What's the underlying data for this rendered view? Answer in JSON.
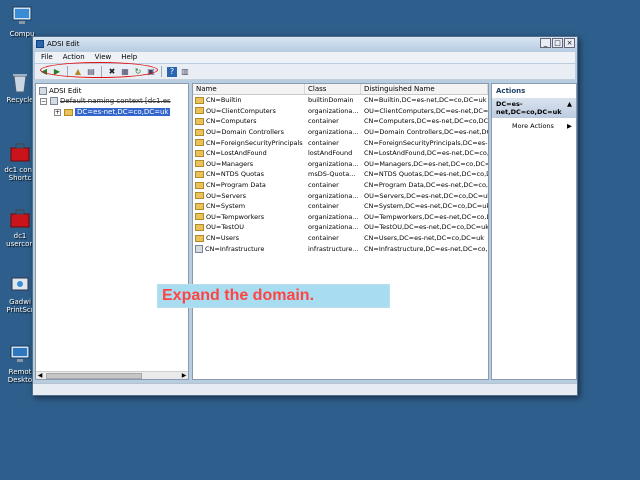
{
  "desktop": {
    "icons": [
      {
        "label": "Compu",
        "icon": "computer-icon"
      },
      {
        "label": "Recycle",
        "icon": "recycle-bin-icon"
      },
      {
        "label": "dc1 cons",
        "label2": "Shortc",
        "icon": "toolbox-icon"
      },
      {
        "label": "dc1",
        "label2": "usercon",
        "icon": "toolbox-icon"
      },
      {
        "label": "Gadwi",
        "label2": "PrintScr",
        "icon": "printscreen-icon"
      },
      {
        "label": "Remot",
        "label2": "Deskto",
        "icon": "remote-desktop-icon"
      }
    ]
  },
  "window": {
    "title": "ADSI Edit",
    "buttons": {
      "minimize": "_",
      "maximize": "□",
      "close": "×"
    }
  },
  "menu": [
    "File",
    "Action",
    "View",
    "Help"
  ],
  "tree": {
    "root": "ADSI Edit",
    "context": "Default naming context [dc1.es",
    "selected": "DC=es-net,DC=co,DC=uk"
  },
  "list": {
    "columns": [
      "Name",
      "Class",
      "Distinguished Name"
    ],
    "rows": [
      {
        "name": "CN=Builtin",
        "class": "builtinDomain",
        "dn": "CN=Builtin,DC=es-net,DC=co,DC=uk",
        "icon": "folder"
      },
      {
        "name": "OU=ClientComputers",
        "class": "organizationa...",
        "dn": "OU=ClientComputers,DC=es-net,DC=co,D",
        "icon": "folder"
      },
      {
        "name": "CN=Computers",
        "class": "container",
        "dn": "CN=Computers,DC=es-net,DC=co,DC=uk",
        "icon": "folder"
      },
      {
        "name": "OU=Domain Controllers",
        "class": "organizationa...",
        "dn": "OU=Domain Controllers,DC=es-net,DC=co",
        "icon": "folder"
      },
      {
        "name": "CN=ForeignSecurityPrincipals",
        "class": "container",
        "dn": "CN=ForeignSecurityPrincipals,DC=es-net",
        "icon": "folder"
      },
      {
        "name": "CN=LostAndFound",
        "class": "lostAndFound",
        "dn": "CN=LostAndFound,DC=es-net,DC=co,DC",
        "icon": "folder"
      },
      {
        "name": "OU=Managers",
        "class": "organizationa...",
        "dn": "OU=Managers,DC=es-net,DC=co,DC=u",
        "icon": "folder"
      },
      {
        "name": "CN=NTDS Quotas",
        "class": "msDS-Quota...",
        "dn": "CN=NTDS Quotas,DC=es-net,DC=co,DC",
        "icon": "folder"
      },
      {
        "name": "CN=Program Data",
        "class": "container",
        "dn": "CN=Program Data,DC=es-net,DC=co,DC",
        "icon": "folder"
      },
      {
        "name": "OU=Servers",
        "class": "organizationa...",
        "dn": "OU=Servers,DC=es-net,DC=co,DC=uk",
        "icon": "folder"
      },
      {
        "name": "CN=System",
        "class": "container",
        "dn": "CN=System,DC=es-net,DC=co,DC=uk",
        "icon": "folder"
      },
      {
        "name": "OU=Tempworkers",
        "class": "organizationa...",
        "dn": "OU=Tempworkers,DC=es-net,DC=co,DC",
        "icon": "folder"
      },
      {
        "name": "OU=TestOU",
        "class": "organizationa...",
        "dn": "OU=TestOU,DC=es-net,DC=co,DC=uk",
        "icon": "folder"
      },
      {
        "name": "CN=Users",
        "class": "container",
        "dn": "CN=Users,DC=es-net,DC=co,DC=uk",
        "icon": "folder"
      },
      {
        "name": "CN=Infrastructure",
        "class": "infrastructure...",
        "dn": "CN=Infrastructure,DC=es-net,DC=co,DC",
        "icon": "object"
      }
    ]
  },
  "actions": {
    "title": "Actions",
    "section": "DC=es-net,DC=co,DC=uk",
    "items": [
      "More Actions"
    ]
  },
  "callout": {
    "text": "Expand the domain."
  },
  "colors": {
    "desktop": "#2e5f8c",
    "selection": "#3366cc",
    "callout_text": "#ff4444",
    "callout_bg": "#a8dcf0",
    "highlight_ring": "#e01010"
  }
}
